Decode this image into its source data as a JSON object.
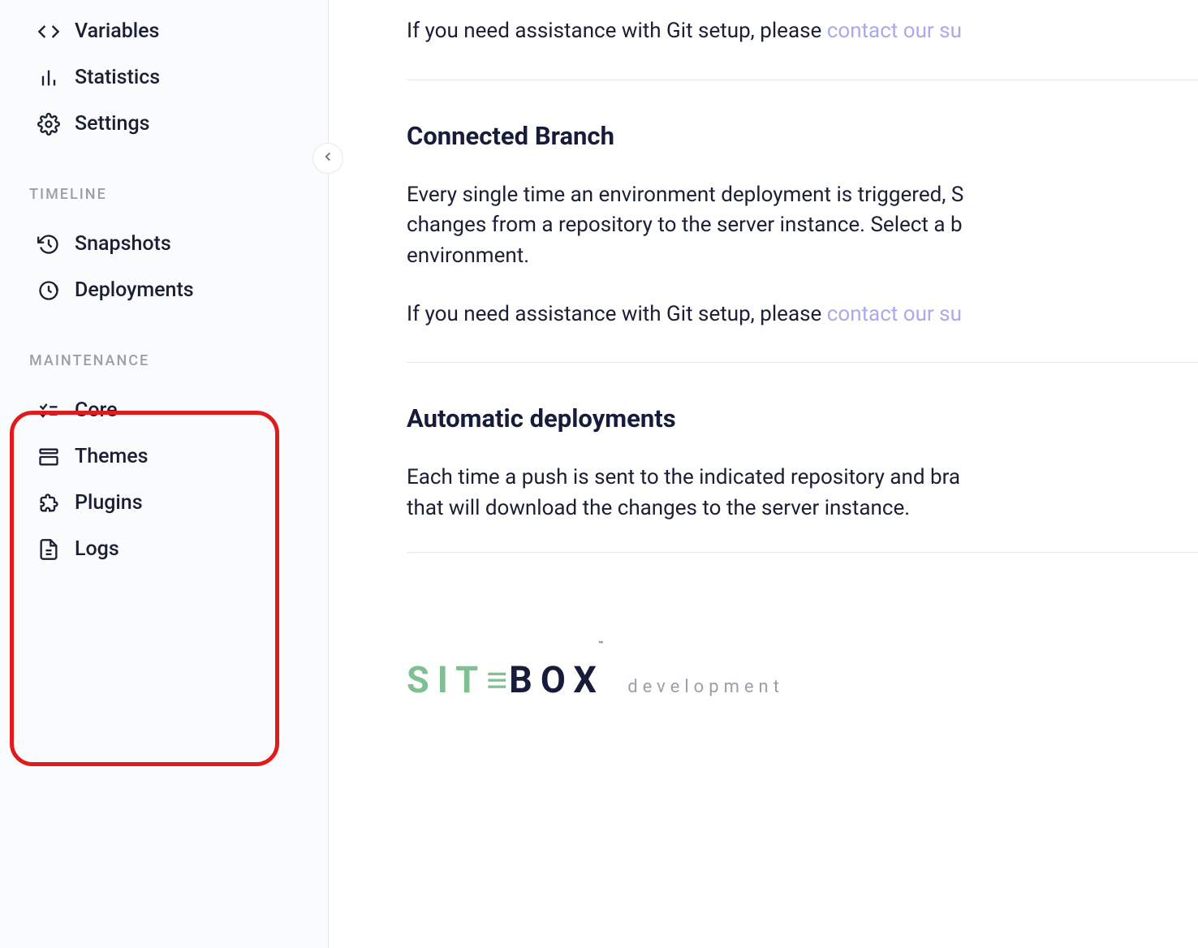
{
  "sidebar": {
    "items_top": [
      {
        "label": "Variables",
        "icon": "code-icon",
        "name": "sidebar-item-variables"
      },
      {
        "label": "Statistics",
        "icon": "bar-chart-icon",
        "name": "sidebar-item-statistics"
      },
      {
        "label": "Settings",
        "icon": "gear-icon",
        "name": "sidebar-item-settings"
      }
    ],
    "section_timeline": {
      "header": "TIMELINE",
      "items": [
        {
          "label": "Snapshots",
          "icon": "history-icon",
          "name": "sidebar-item-snapshots"
        },
        {
          "label": "Deployments",
          "icon": "clock-refresh-icon",
          "name": "sidebar-item-deployments"
        }
      ]
    },
    "section_maintenance": {
      "header": "MAINTENANCE",
      "items": [
        {
          "label": "Core",
          "icon": "checklist-icon",
          "name": "sidebar-item-core"
        },
        {
          "label": "Themes",
          "icon": "layout-icon",
          "name": "sidebar-item-themes"
        },
        {
          "label": "Plugins",
          "icon": "puzzle-icon",
          "name": "sidebar-item-plugins"
        },
        {
          "label": "Logs",
          "icon": "file-icon",
          "name": "sidebar-item-logs"
        }
      ]
    }
  },
  "main": {
    "assist_text_prefix": "If you need assistance with Git setup, please ",
    "assist_link": "contact our su",
    "section_branch": {
      "title": "Connected Branch",
      "body_line1": "Every single time an environment deployment is triggered, S",
      "body_line2": "changes from a repository to the server instance. Select a b",
      "body_line3": "environment.",
      "assist_text_prefix": "If you need assistance with Git setup, please ",
      "assist_link": "contact our su"
    },
    "section_auto": {
      "title": "Automatic deployments",
      "body_line1": "Each time a push is sent to the indicated repository and bra",
      "body_line2": "that will download the changes to the server instance."
    }
  },
  "footer": {
    "logo_site": "SIT",
    "logo_box": "BOX",
    "logo_sub": "development"
  }
}
